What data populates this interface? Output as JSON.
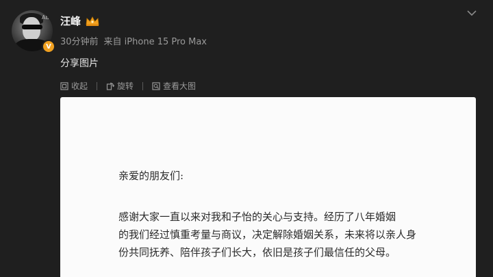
{
  "post": {
    "username": "汪峰",
    "timestamp": "30分钟前",
    "source": "来自 iPhone 15 Pro Max",
    "text": "分享图片",
    "verified_badge": "V",
    "avatar_scribble": "ABC"
  },
  "toolbar": {
    "collapse_label": "收起",
    "rotate_label": "旋转",
    "view_large_label": "查看大图"
  },
  "image": {
    "greeting": "亲爱的朋友们:",
    "body_lines": [
      "感谢大家一直以来对我和子怡的关心与支持。经历了八年婚姻",
      "的我们经过慎重考量与商议，决定解除婚姻关系，未来将以亲人身",
      "份共同抚养、陪伴孩子们长大，依旧是孩子们最信任的父母。"
    ]
  },
  "icons": {
    "crown": "crown-icon",
    "collapse": "collapse-icon",
    "rotate": "rotate-icon",
    "view_large": "view-large-icon",
    "menu": "chevron-down-icon"
  },
  "colors": {
    "background": "#1f1f1f",
    "crown": "#f0a020",
    "meta_text": "#9a9a9a",
    "letter_bg": "#fbfbfb"
  }
}
